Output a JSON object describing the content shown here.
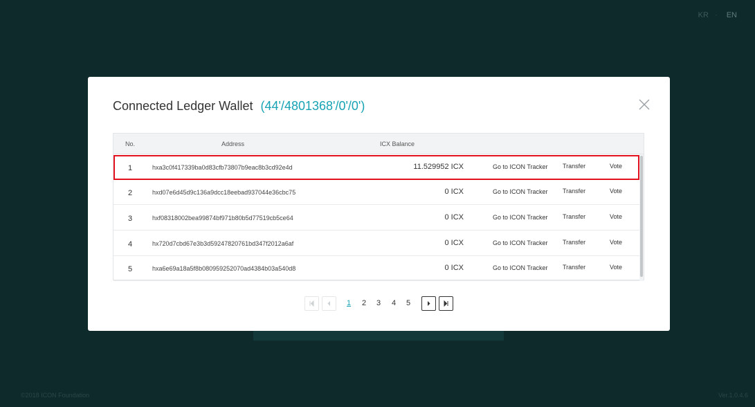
{
  "lang": {
    "options": [
      "KR",
      "EN"
    ],
    "active": "EN"
  },
  "footer": {
    "copyright": "©2018 ICON Foundation",
    "version": "Ver.1.0.4.6"
  },
  "modal": {
    "title": "Connected Ledger Wallet",
    "path": "(44'/4801368'/0'/0')",
    "close_icon": "close-icon"
  },
  "table": {
    "headers": {
      "no": "No.",
      "address": "Address",
      "balance": "ICX Balance"
    },
    "rows": [
      {
        "no": "1",
        "address": "hxa3c0f417339ba0d83cfb73807b9eac8b3cd92e4d",
        "balance": "11.529952 ICX",
        "tracker": "Go to ICON Tracker",
        "transfer": "Transfer",
        "vote": "Vote",
        "selected": true
      },
      {
        "no": "2",
        "address": "hxd07e6d45d9c136a9dcc18eebad937044e36cbc75",
        "balance": "0 ICX",
        "tracker": "Go to ICON Tracker",
        "transfer": "Transfer",
        "vote": "Vote"
      },
      {
        "no": "3",
        "address": "hxf08318002bea99874bf971b80b5d77519cb5ce64",
        "balance": "0 ICX",
        "tracker": "Go to ICON Tracker",
        "transfer": "Transfer",
        "vote": "Vote"
      },
      {
        "no": "4",
        "address": "hx720d7cbd67e3b3d59247820761bd347f2012a6af",
        "balance": "0 ICX",
        "tracker": "Go to ICON Tracker",
        "transfer": "Transfer",
        "vote": "Vote"
      },
      {
        "no": "5",
        "address": "hxa6e69a18a5f8b080959252070ad4384b03a540d8",
        "balance": "0 ICX",
        "tracker": "Go to ICON Tracker",
        "transfer": "Transfer",
        "vote": "Vote"
      }
    ]
  },
  "pagination": {
    "pages": [
      "1",
      "2",
      "3",
      "4",
      "5"
    ],
    "current": "1"
  },
  "colors": {
    "accent": "#17a3b4",
    "highlight": "#e3111d",
    "background": "#0f2a2b"
  }
}
